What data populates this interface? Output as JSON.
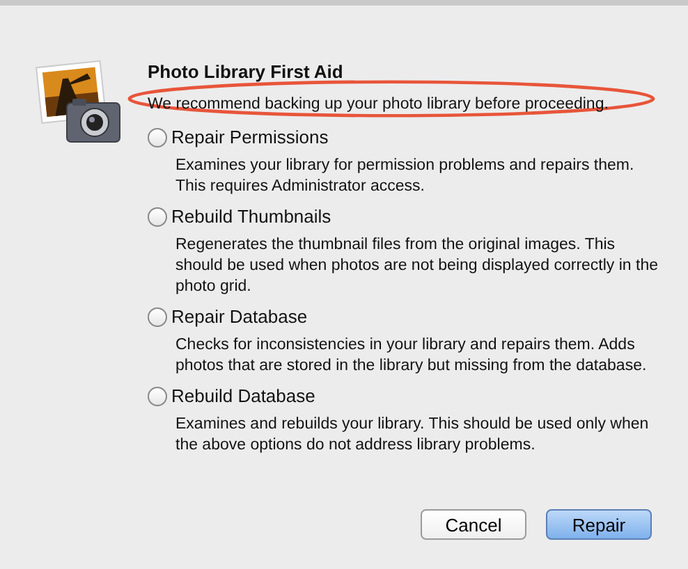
{
  "dialog": {
    "title": "Photo Library First Aid",
    "subtitle": {
      "text": "We recommend backing up your photo library before proceeding.",
      "circled": true
    }
  },
  "options": [
    {
      "label": "Repair Permissions",
      "selected": false,
      "description": "Examines your library for permission problems and repairs them. This requires Administrator access."
    },
    {
      "label": "Rebuild Thumbnails",
      "selected": false,
      "description": "Regenerates the thumbnail files from the original images. This should be used when photos are not being displayed correctly in the photo grid."
    },
    {
      "label": "Repair Database",
      "selected": false,
      "description": "Checks for inconsistencies in your library and repairs them. Adds photos that are stored in the library but missing from the database."
    },
    {
      "label": "Rebuild Database",
      "selected": false,
      "description": "Examines and rebuilds your library. This should be used only when the above options do not address library problems."
    }
  ],
  "buttons": [
    {
      "label": "Cancel",
      "kind": "normal"
    },
    {
      "label": "Repair",
      "kind": "default"
    }
  ]
}
